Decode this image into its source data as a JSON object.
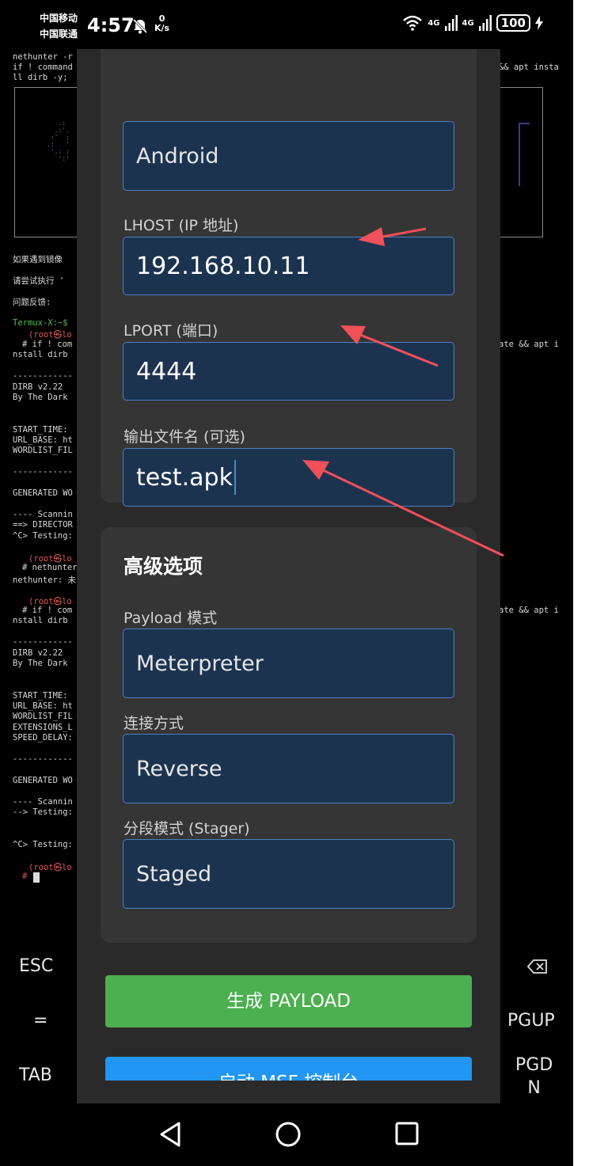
{
  "status_bar": {
    "carrier1": "中国移动",
    "carrier2": "中国联通",
    "time": "4:57",
    "net_speed_value": "0",
    "net_speed_unit": "K/s",
    "sig1": "4G",
    "sig2": "4G",
    "battery": "100"
  },
  "terminal": {
    "lines_top": [
      "nethunter -r",
      "if ! command",
      "ll dirb -y;"
    ],
    "right_top": "&& apt insta",
    "notes": [
      "如果遇到镜像",
      "请尝试执行 '",
      "问题反馈:"
    ],
    "prompt": "Termux-X:~$",
    "root_prompt": "(root㉿lo",
    "cmd_if": "# if ! com",
    "cmd_nethunter": "# nethunter",
    "nethunter_out": "nethunter: 未",
    "hash": "#",
    "nstall": "nstall dirb",
    "right_mid": "ate && apt i",
    "sep": "------------",
    "dirb_ver": "DIRB v2.22",
    "by_dark": "By The Dark",
    "start_time": "START_TIME:",
    "url_base": "URL_BASE: ht",
    "wordlist": "WORDLIST_FIL",
    "extensions": "EXTENSIONS_L",
    "speed_delay": "SPEED_DELAY:",
    "generated": "GENERATED WO",
    "scanning": "---- Scannin",
    "directory": "==> DIRECTOR",
    "testing_ctrl": "^C> Testing:",
    "testing": "--> Testing:"
  },
  "extra_keys": {
    "esc": "ESC",
    "eq": "=",
    "tab": "TAB",
    "pgup": "PGUP",
    "pgdn_1": "PGD",
    "pgdn_2": "N"
  },
  "form": {
    "platform_value": "Android",
    "lhost_label": "LHOST (IP 地址)",
    "lhost_value": "192.168.10.11",
    "lport_label": "LPORT (端口)",
    "lport_value": "4444",
    "output_label": "输出文件名 (可选)",
    "output_value": "test.apk"
  },
  "advanced": {
    "title": "高级选项",
    "payload_mode_label": "Payload 模式",
    "payload_mode_value": "Meterpreter",
    "connection_label": "连接方式",
    "connection_value": "Reverse",
    "stager_label": "分段模式 (Stager)",
    "stager_value": "Staged"
  },
  "buttons": {
    "generate": "生成 PAYLOAD",
    "msf": "启动 MSF 控制台"
  },
  "colors": {
    "generate_button": "#4caf50",
    "msf_button": "#2196f3",
    "field_bg": "#1c3350",
    "field_border": "#4d7fc2",
    "annotation_arrow": "#f0505a"
  }
}
